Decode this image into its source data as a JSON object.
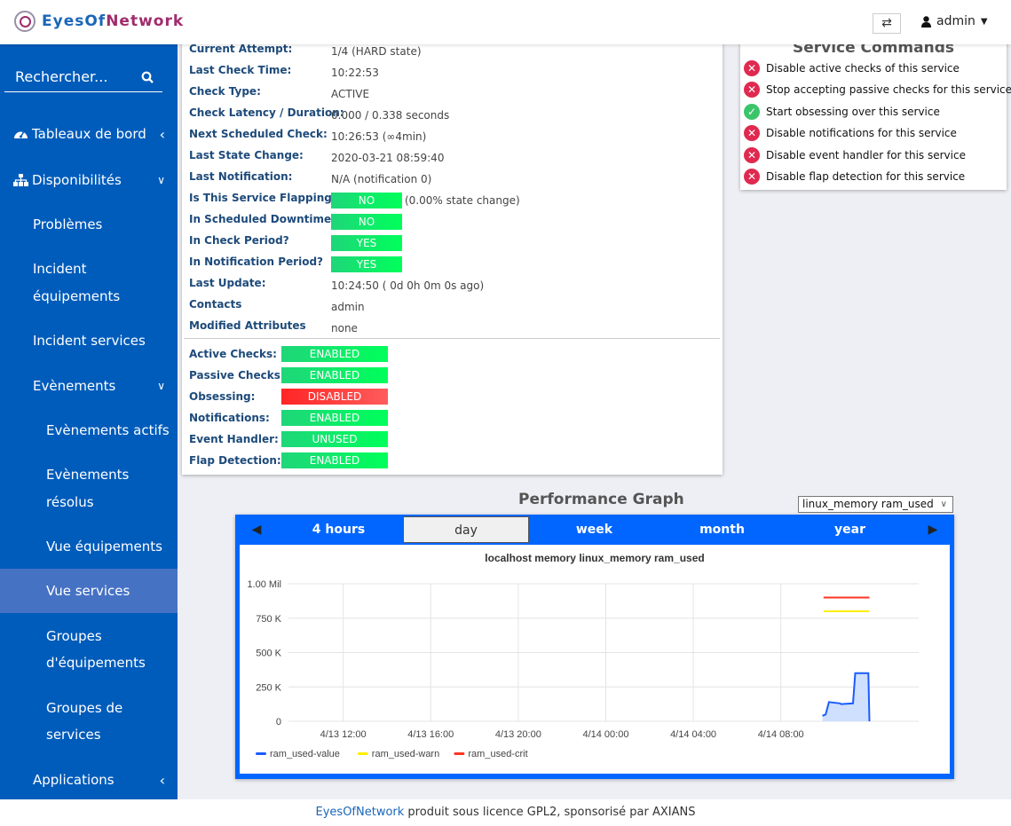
{
  "header": {
    "logo_part1": "Eyes",
    "logo_part2": "Of",
    "logo_part3": "Network",
    "swap_icon": "⇄",
    "user_label": "admin"
  },
  "sidebar": {
    "search_placeholder": "Rechercher...",
    "items": [
      {
        "label": "Tableaux de bord",
        "icon": "dashboard-icon",
        "chevron": "‹"
      },
      {
        "label": "Disponibilités",
        "icon": "sitemap-icon",
        "chevron": "⌄"
      },
      {
        "label": "Problèmes"
      },
      {
        "label": "Incident",
        "label2": "équipements"
      },
      {
        "label": "Incident services"
      },
      {
        "label": "Evènements",
        "chevron": "⌄"
      },
      {
        "label": "Evènements actifs"
      },
      {
        "label": "Evènements",
        "label2": "résolus"
      },
      {
        "label": "Vue équipements"
      },
      {
        "label": "Vue services",
        "active": true
      },
      {
        "label": "Groupes",
        "label2": "d'équipements"
      },
      {
        "label": "Groupes de",
        "label2": "services"
      },
      {
        "label": "Applications",
        "chevron": "‹"
      }
    ]
  },
  "details": {
    "rows": [
      {
        "label": "Current Attempt:",
        "value": "1/4  (HARD state)"
      },
      {
        "label": "Last Check Time:",
        "value": "10:22:53"
      },
      {
        "label": "Check Type:",
        "value": "ACTIVE"
      },
      {
        "label": "Check Latency / Duration:",
        "value": "0.000 / 0.338 seconds"
      },
      {
        "label": "Next Scheduled Check:",
        "value": "10:26:53 (∞4min)"
      },
      {
        "label": "Last State Change:",
        "value": "2020-03-21 08:59:40"
      },
      {
        "label": "Last Notification:",
        "value": "N/A (notification 0)"
      },
      {
        "label": "Is This Service Flapping?",
        "badge": "NO",
        "extra": "(0.00% state change)"
      },
      {
        "label": "In Scheduled Downtime?",
        "badge": "NO"
      },
      {
        "label": "In Check Period?",
        "badge": "YES"
      },
      {
        "label": "In Notification Period?",
        "badge": "YES"
      },
      {
        "label": "Last Update:",
        "value": "10:24:50  ( 0d 0h 0m 0s ago)"
      },
      {
        "label": "Contacts",
        "value": "admin"
      },
      {
        "label": "Modified Attributes",
        "value": "none"
      }
    ],
    "flags": [
      {
        "label": "Active Checks:",
        "value": "ENABLED",
        "status": "ok"
      },
      {
        "label": "Passive Checks:",
        "value": "ENABLED",
        "status": "ok"
      },
      {
        "label": "Obsessing:",
        "value": "DISABLED",
        "status": "bad"
      },
      {
        "label": "Notifications:",
        "value": "ENABLED",
        "status": "ok"
      },
      {
        "label": "Event Handler:",
        "value": "UNUSED",
        "status": "ok"
      },
      {
        "label": "Flap Detection:",
        "value": "ENABLED",
        "status": "ok"
      }
    ]
  },
  "commands": {
    "title": "Service Commands",
    "items": [
      {
        "label": "Disable active checks of this service",
        "icon": "x"
      },
      {
        "label": "Stop accepting passive checks for this service",
        "icon": "x"
      },
      {
        "label": "Start obsessing over this service",
        "icon": "ok"
      },
      {
        "label": "Disable notifications for this service",
        "icon": "x"
      },
      {
        "label": "Disable event handler for this service",
        "icon": "x"
      },
      {
        "label": "Disable flap detection for this service",
        "icon": "x"
      }
    ]
  },
  "performance": {
    "title": "Performance Graph",
    "datasource": "linux_memory ram_used",
    "tabs": [
      "4 hours",
      "day",
      "week",
      "month",
      "year"
    ],
    "selected_tab": "day"
  },
  "chart_data": {
    "type": "line",
    "title": "localhost memory linux_memory ram_used",
    "xlabel": "",
    "ylabel": "",
    "x_tick_labels": [
      "4/13 12:00",
      "4/13 16:00",
      "4/13 20:00",
      "4/14 00:00",
      "4/14 04:00",
      "4/14 08:00"
    ],
    "x_range_hours": [
      -2.5,
      26.3
    ],
    "y_tick_labels": [
      "0",
      "250 K",
      "500 K",
      "750 K",
      "1.00 Mil"
    ],
    "y_ticks": [
      0,
      250000,
      500000,
      750000,
      1000000
    ],
    "ylim": [
      0,
      1000000
    ],
    "grid": true,
    "legend_position": "bottom-left",
    "series": [
      {
        "name": "ram_used-value",
        "color": "#1a5cff",
        "fill": true,
        "x_hours": [
          21.9,
          22.05,
          22.2,
          22.7,
          22.75,
          23.3,
          23.4,
          24.0,
          24.05
        ],
        "values": [
          40000,
          50000,
          140000,
          130000,
          125000,
          130000,
          350000,
          350000,
          0
        ]
      },
      {
        "name": "ram_used-warn",
        "color": "#ffee00",
        "x_hours": [
          21.95,
          24.05
        ],
        "values": [
          800000,
          800000
        ]
      },
      {
        "name": "ram_used-crit",
        "color": "#ff3322",
        "x_hours": [
          21.95,
          24.05
        ],
        "values": [
          900000,
          900000
        ]
      }
    ]
  },
  "footer": {
    "link": "EyesOfNetwork",
    "text": " produit sous licence GPL2, sponsorisé par AXIANS"
  }
}
